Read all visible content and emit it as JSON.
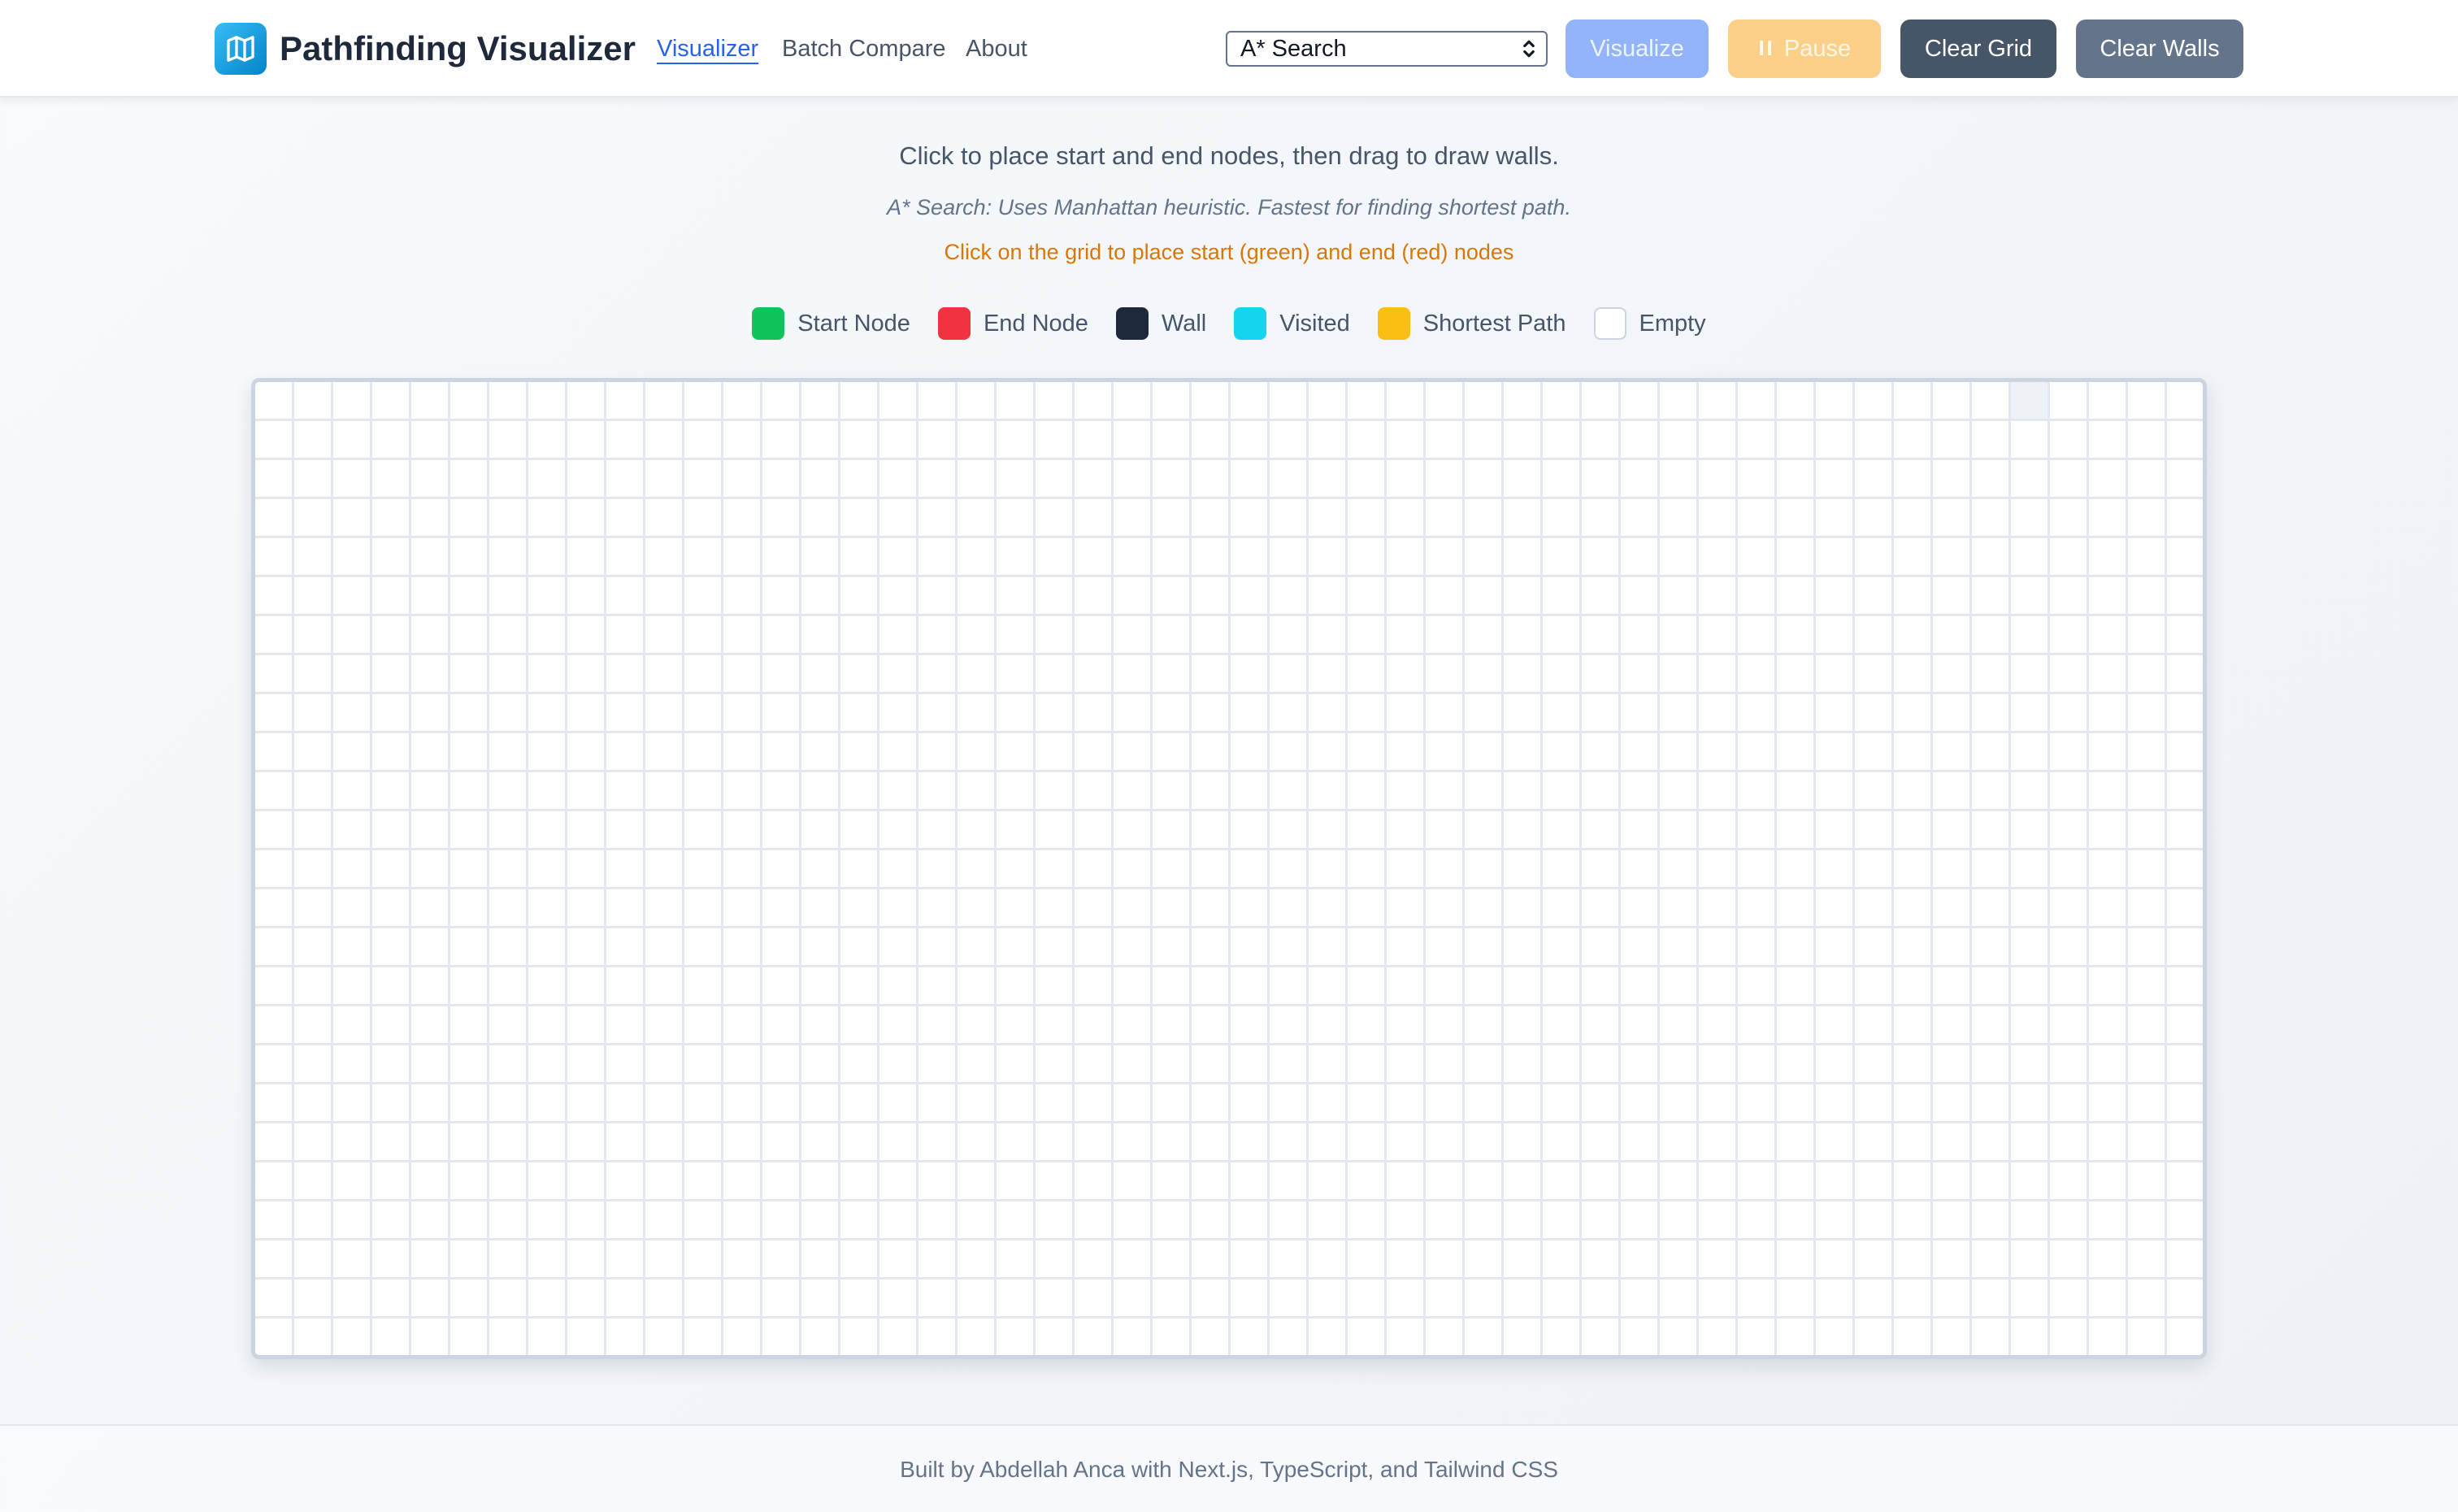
{
  "app": {
    "title": "Pathfinding Visualizer",
    "logo_icon": "map-icon"
  },
  "nav": {
    "items": [
      {
        "label": "Visualizer",
        "active": true
      },
      {
        "label": "Batch Compare",
        "active": false
      },
      {
        "label": "About",
        "active": false
      }
    ]
  },
  "controls": {
    "algorithm_select": {
      "value": "A* Search"
    },
    "visualize_label": "Visualize",
    "pause_label": "Pause",
    "clear_grid_label": "Clear Grid",
    "clear_walls_label": "Clear Walls"
  },
  "instructions": {
    "main": "Click to place start and end nodes, then drag to draw walls.",
    "algorithm_description": "A* Search: Uses Manhattan heuristic. Fastest for finding shortest path.",
    "hint": "Click on the grid to place start (green) and end (red) nodes"
  },
  "legend": {
    "items": [
      {
        "label": "Start Node",
        "color": "#10c35b"
      },
      {
        "label": "End Node",
        "color": "#ef3340"
      },
      {
        "label": "Wall",
        "color": "#1e293b"
      },
      {
        "label": "Visited",
        "color": "#14d4ee"
      },
      {
        "label": "Shortest Path",
        "color": "#fbbf14"
      },
      {
        "label": "Empty",
        "color": "#ffffff"
      }
    ]
  },
  "grid": {
    "rows": 25,
    "cols": 50,
    "hovered_cell": {
      "row": 0,
      "col": 45
    }
  },
  "footer": {
    "text": "Built by Abdellah Anca with Next.js, TypeScript, and Tailwind CSS"
  },
  "colors": {
    "accent": "#2563eb",
    "logo": "#0ea5e9",
    "visualize_button": "#93b4fb",
    "pause_button": "#fcd088",
    "clear_grid_button": "#475569",
    "clear_walls_button": "#64748b",
    "hint_text": "#d97706"
  }
}
